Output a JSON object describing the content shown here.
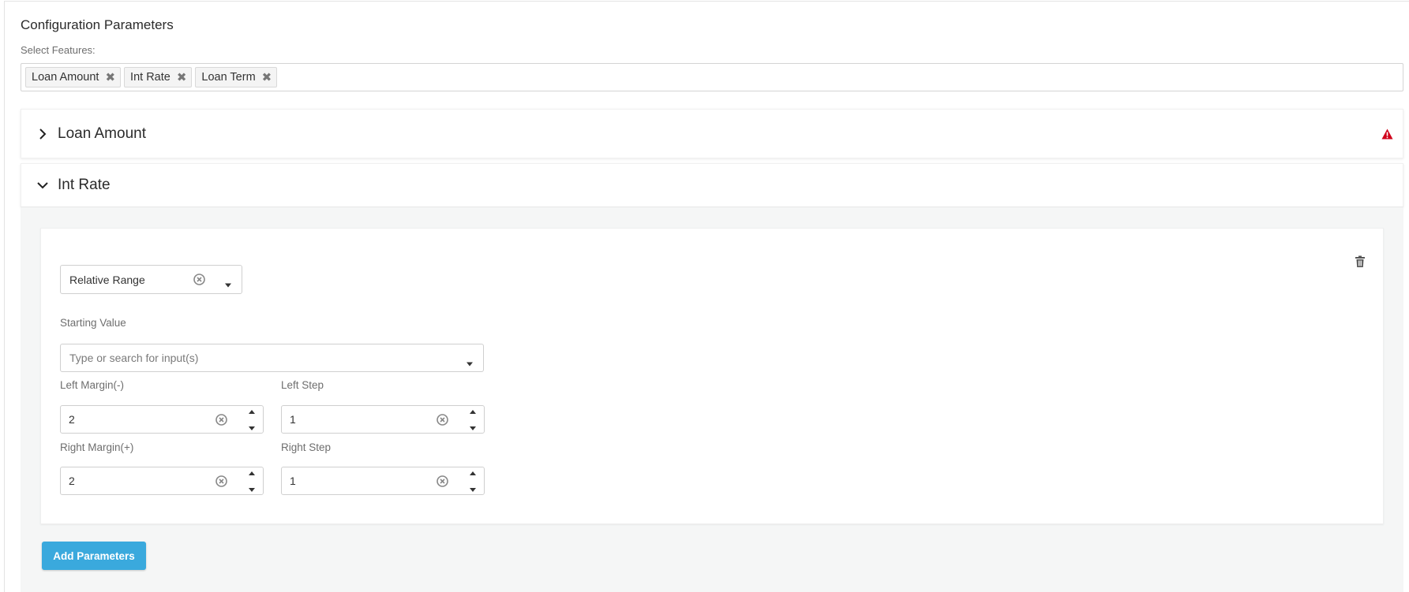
{
  "page": {
    "title": "Configuration Parameters",
    "select_features_label": "Select Features:"
  },
  "features": {
    "tags": [
      "Loan Amount",
      "Int Rate",
      "Loan Term"
    ],
    "remove_glyph": "✖"
  },
  "accordions": [
    {
      "title": "Loan Amount",
      "expanded": false,
      "warning": true,
      "icon": "chevron-right-icon"
    },
    {
      "title": "Int Rate",
      "expanded": true,
      "warning": false,
      "icon": "chevron-down-icon"
    }
  ],
  "int_rate_card": {
    "range_type": "Relative Range",
    "starting_value_label": "Starting Value",
    "starting_value_placeholder": "Type or search for input(s)",
    "left_margin_label": "Left Margin(-)",
    "left_margin_value": "2",
    "left_step_label": "Left Step",
    "left_step_value": "1",
    "right_margin_label": "Right Margin(+)",
    "right_margin_value": "2",
    "right_step_label": "Right Step",
    "right_step_value": "1"
  },
  "actions": {
    "add_parameters_label": "Add Parameters"
  },
  "colors": {
    "accent": "#3aa9dd",
    "warning": "#d0021b",
    "panel_bg": "#f5f6f6"
  }
}
